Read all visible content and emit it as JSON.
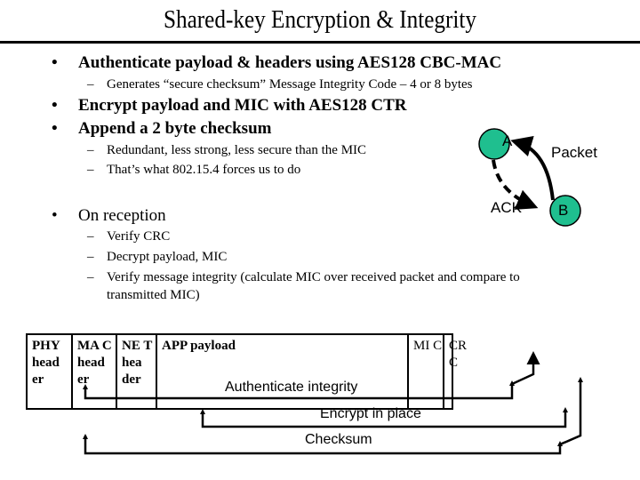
{
  "slide": {
    "title": "Shared-key Encryption & Integrity",
    "bullets": [
      {
        "text": "Authenticate payload & headers using AES128 CBC-MAC",
        "sub": [
          "Generates “secure checksum” Message Integrity Code – 4 or 8 bytes"
        ]
      },
      {
        "text": "Encrypt payload and MIC with AES128 CTR",
        "sub": []
      },
      {
        "text": "Append a 2 byte checksum",
        "sub": [
          "Redundant, less strong, less secure than the MIC",
          "That’s what 802.15.4 forces us to do"
        ]
      },
      {
        "text": "On reception",
        "sub": [
          "Verify CRC",
          "Decrypt payload, MIC",
          "Verify message integrity (calculate MIC over received packet and compare to",
          "transmitted MIC)"
        ]
      }
    ],
    "bullet_glyph": "•",
    "dash_glyph": "–"
  },
  "diagram": {
    "node_a": "A",
    "node_b": "B",
    "packet_label": "Packet",
    "ack_label": "ACK",
    "node_color": "#1fbf8f"
  },
  "packet": {
    "fields": [
      {
        "name": "phy",
        "label": "PHY head er"
      },
      {
        "name": "mac",
        "label": "MA C head er"
      },
      {
        "name": "net",
        "label": "NE T hea der"
      },
      {
        "name": "app",
        "label": "APP payload"
      },
      {
        "name": "mic",
        "label": "MI C"
      },
      {
        "name": "crc",
        "label": "CR C"
      }
    ],
    "authenticate_label": "Authenticate integrity",
    "encrypt_label": "Encrypt in place",
    "checksum_label": "Checksum"
  }
}
